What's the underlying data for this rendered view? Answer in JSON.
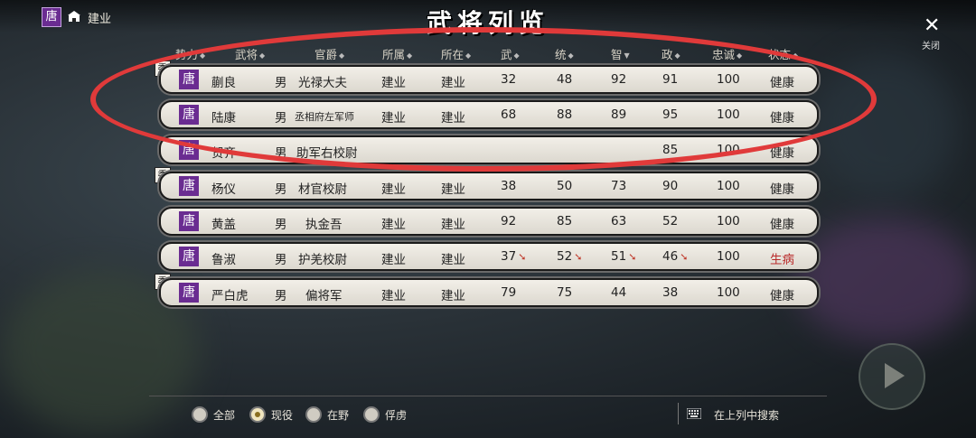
{
  "topbar": {
    "faction_char": "唐",
    "city_name": "建业"
  },
  "title": "武将列览",
  "close": {
    "label": "关闭"
  },
  "columns": [
    "势力",
    "武将",
    "官爵",
    "所属",
    "所在",
    "武",
    "统",
    "智",
    "政",
    "忠诚",
    "状态"
  ],
  "rows": [
    {
      "wei": "委",
      "faction": "唐",
      "name": "蒯良",
      "gender": "男",
      "rank": "光禄大夫",
      "belong": "建业",
      "location": "建业",
      "wu": "32",
      "tong": "48",
      "zhi": "92",
      "zheng": "91",
      "loyalty": "100",
      "status": "健康"
    },
    {
      "wei": "",
      "faction": "唐",
      "name": "陆康",
      "gender": "男",
      "rank": "丞相府左军师",
      "belong": "建业",
      "location": "建业",
      "wu": "68",
      "tong": "88",
      "zhi": "89",
      "zheng": "95",
      "loyalty": "100",
      "status": "健康"
    },
    {
      "wei": "",
      "faction": "唐",
      "name": "贺齐",
      "gender": "男",
      "rank": "助军右校尉",
      "belong": "",
      "location": "",
      "wu": "",
      "tong": "",
      "zhi": "",
      "zheng": "85",
      "loyalty": "100",
      "status": "健康"
    },
    {
      "wei": "委",
      "faction": "唐",
      "name": "杨仪",
      "gender": "男",
      "rank": "材官校尉",
      "belong": "建业",
      "location": "建业",
      "wu": "38",
      "tong": "50",
      "zhi": "73",
      "zheng": "90",
      "loyalty": "100",
      "status": "健康"
    },
    {
      "wei": "",
      "faction": "唐",
      "name": "黄盖",
      "gender": "男",
      "rank": "执金吾",
      "belong": "建业",
      "location": "建业",
      "wu": "92",
      "tong": "85",
      "zhi": "63",
      "zheng": "52",
      "loyalty": "100",
      "status": "健康"
    },
    {
      "wei": "",
      "faction": "唐",
      "name": "鲁淑",
      "gender": "男",
      "rank": "护羌校尉",
      "belong": "建业",
      "location": "建业",
      "wu": "37",
      "tong": "52",
      "zhi": "51",
      "zheng": "46",
      "loyalty": "100",
      "status": "生病"
    },
    {
      "wei": "委",
      "faction": "唐",
      "name": "严白虎",
      "gender": "男",
      "rank": "偏将军",
      "belong": "建业",
      "location": "建业",
      "wu": "79",
      "tong": "75",
      "zhi": "44",
      "zheng": "38",
      "loyalty": "100",
      "status": "健康"
    }
  ],
  "filters": [
    {
      "label": "全部",
      "selected": false
    },
    {
      "label": "现役",
      "selected": true
    },
    {
      "label": "在野",
      "selected": false
    },
    {
      "label": "俘虏",
      "selected": false
    }
  ],
  "search_label": "在上列中搜索",
  "colors": {
    "faction": "#6a2c91",
    "circle": "#e03a3a",
    "sick": "#b92b2b"
  }
}
